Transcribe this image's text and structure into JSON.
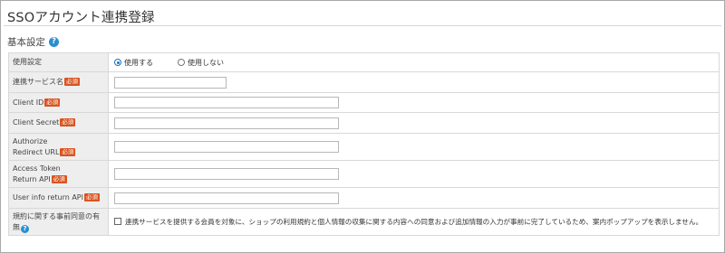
{
  "page": {
    "title": "SSOアカウント連携登録",
    "section_title": "基本設定",
    "section_help_icon": "help-icon"
  },
  "required_badge": "必須",
  "rows": {
    "usage": {
      "label": "使用設定",
      "options": [
        "使用する",
        "使用しない"
      ],
      "selected": "使用する"
    },
    "service_name": {
      "label": "連携サービス名",
      "value": ""
    },
    "client_id": {
      "label": "Client ID",
      "value": ""
    },
    "client_secret": {
      "label": "Client Secret",
      "value": ""
    },
    "authorize_redirect_url": {
      "label_line1": "Authorize",
      "label_line2": "Redirect URL",
      "value": ""
    },
    "access_token_return_api": {
      "label_line1": "Access Token",
      "label_line2": "Return API",
      "value": ""
    },
    "user_info_return_api": {
      "label": "User info return API",
      "value": ""
    },
    "terms_consent": {
      "label_line1": "規約に関する事前同意の有",
      "label_line2": "無",
      "checked": false,
      "text": "連携サービスを提供する会員を対象に、ショップの利用規約と個人情報の収集に関する内容への同意および追加情報の入力が事前に完了しているため、案内ポップアップを表示しません。"
    }
  },
  "colors": {
    "badge": "#d9541e",
    "help": "#2b8fcf",
    "label_bg": "#eeeeee",
    "radio_selected": "#1a73c8"
  }
}
